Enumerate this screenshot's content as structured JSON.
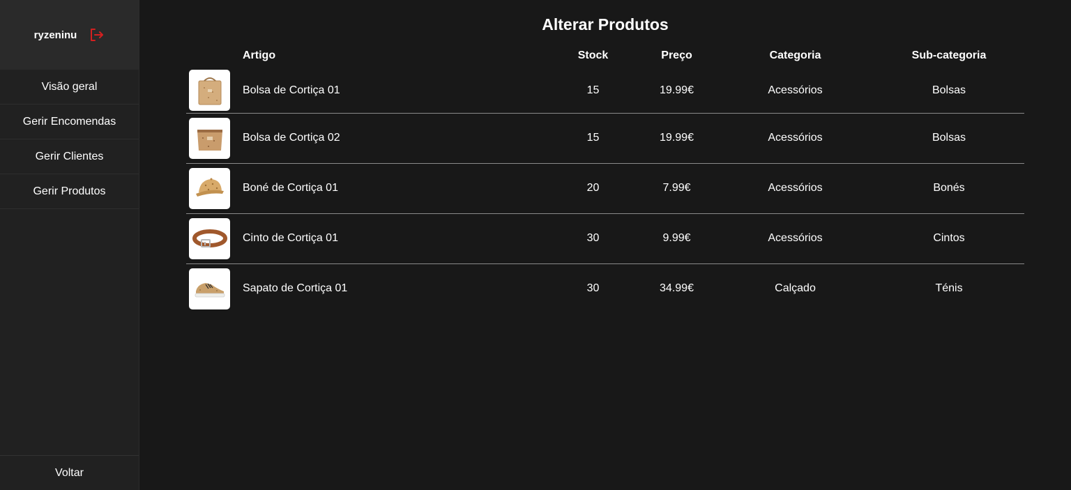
{
  "sidebar": {
    "username": "ryzeninu",
    "logout_icon": "logout-icon",
    "items": [
      {
        "label": "Visão geral"
      },
      {
        "label": "Gerir Encomendas"
      },
      {
        "label": "Gerir Clientes"
      },
      {
        "label": "Gerir Produtos"
      }
    ],
    "back_label": "Voltar"
  },
  "main": {
    "title": "Alterar Produtos",
    "columns": {
      "artigo": "Artigo",
      "stock": "Stock",
      "preco": "Preço",
      "categoria": "Categoria",
      "subcategoria": "Sub-categoria"
    },
    "products": [
      {
        "image": "cork-bag-icon",
        "name": "Bolsa de Cortiça 01",
        "stock": "15",
        "price": "19.99€",
        "category": "Acessórios",
        "subcategory": "Bolsas"
      },
      {
        "image": "cork-pouch-icon",
        "name": "Bolsa de Cortiça 02",
        "stock": "15",
        "price": "19.99€",
        "category": "Acessórios",
        "subcategory": "Bolsas"
      },
      {
        "image": "cork-cap-icon",
        "name": "Boné de Cortiça 01",
        "stock": "20",
        "price": "7.99€",
        "category": "Acessórios",
        "subcategory": "Bonés"
      },
      {
        "image": "cork-belt-icon",
        "name": "Cinto de Cortiça 01",
        "stock": "30",
        "price": "9.99€",
        "category": "Acessórios",
        "subcategory": "Cintos"
      },
      {
        "image": "cork-sneaker-icon",
        "name": "Sapato de Cortiça 01",
        "stock": "30",
        "price": "34.99€",
        "category": "Calçado",
        "subcategory": "Ténis"
      }
    ]
  },
  "colors": {
    "background": "#181818",
    "sidebar": "#212121",
    "user_box": "#2a2a2a",
    "logout_accent": "#d32020",
    "cork": "#c9a06b"
  }
}
